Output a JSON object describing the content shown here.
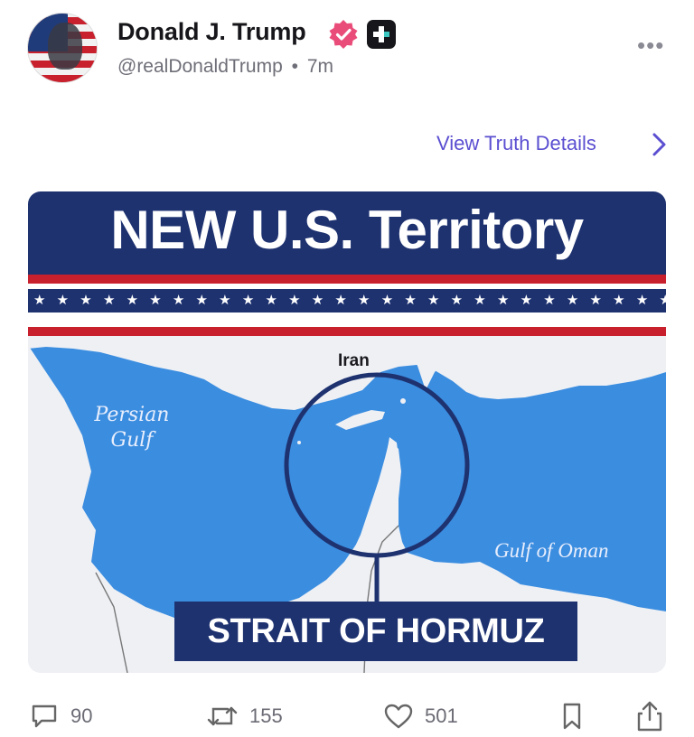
{
  "post": {
    "author_name": "Donald J. Trump",
    "handle": "@realDonaldTrump",
    "separator": "•",
    "time": "7m",
    "view_details_label": "View Truth Details",
    "more_label": "•••"
  },
  "image": {
    "title": "NEW U.S. Territory",
    "stars": "★★★★★★★★★★★★★★★★★★★★★★★★★★★★",
    "labels": {
      "iran": "Iran",
      "persian_gulf": "Persian Gulf",
      "gulf_of_oman": "Gulf of Oman",
      "strait": "STRAIT OF HORMUZ"
    }
  },
  "actions": {
    "replies": "90",
    "retruths": "155",
    "likes": "501"
  },
  "colors": {
    "accent": "#5b4fd1",
    "banner_navy": "#1e3270",
    "banner_red": "#c9202d",
    "water": "#3b8de0",
    "verified_pink": "#ea4c7a"
  },
  "icons": {
    "verified": "verified-badge-icon",
    "plus": "plus-badge-icon",
    "more": "more-dots-icon",
    "chevron": "chevron-right-icon",
    "reply": "comment-icon",
    "retruth": "retruth-icon",
    "like": "heart-icon",
    "bookmark": "bookmark-icon",
    "share": "share-icon"
  }
}
